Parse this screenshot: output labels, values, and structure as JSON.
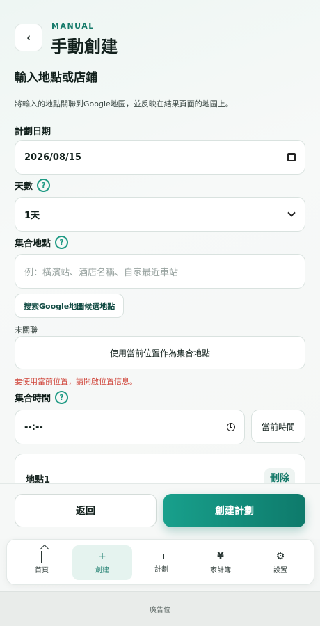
{
  "header": {
    "back_icon": "chevron-left-icon",
    "back_glyph": "‹",
    "eyebrow": "MANUAL",
    "title": "手動創建"
  },
  "section": {
    "title": "輸入地點或店鋪",
    "description": "將輸入的地點關聯到Google地圖，並反映在結果頁面的地圖上。"
  },
  "plan_date": {
    "label": "計劃日期",
    "value": "2026/08/15",
    "icon": "calendar-icon"
  },
  "days": {
    "label": "天數",
    "help": "?",
    "selected": "1天",
    "icon": "chevron-down-icon"
  },
  "meeting_place": {
    "label": "集合地點",
    "help": "?",
    "placeholder": "例：橫濱站、酒店名稱、自家最近車站",
    "google_button": "搜索Google地圖候選地點",
    "link_status": "未關聯",
    "use_location_button": "使用當前位置作為集合地點",
    "error": "要使用當前位置，請開啟位置信息。"
  },
  "meeting_time": {
    "label": "集合時間",
    "help": "?",
    "value": "--:--",
    "icon": "clock-icon",
    "now_button": "當前時間"
  },
  "place_card": {
    "name": "地點1",
    "delete": "刪除"
  },
  "actions": {
    "back": "返回",
    "create": "創建計劃"
  },
  "tabbar": {
    "items": [
      {
        "label": "首頁",
        "icon": "home-icon",
        "glyph": ""
      },
      {
        "label": "創建",
        "icon": "plus-icon",
        "glyph": "+"
      },
      {
        "label": "計劃",
        "icon": "square-icon",
        "glyph": ""
      },
      {
        "label": "家計簿",
        "icon": "yen-icon",
        "glyph": "¥"
      },
      {
        "label": "設置",
        "icon": "gear-icon",
        "glyph": "⚙"
      }
    ],
    "active_index": 1
  },
  "ad": {
    "label": "廣告位"
  },
  "colors": {
    "accent": "#167a6a",
    "error": "#d0463b",
    "create_gradient_start": "#18a08c",
    "create_gradient_end": "#0e7a6b"
  }
}
